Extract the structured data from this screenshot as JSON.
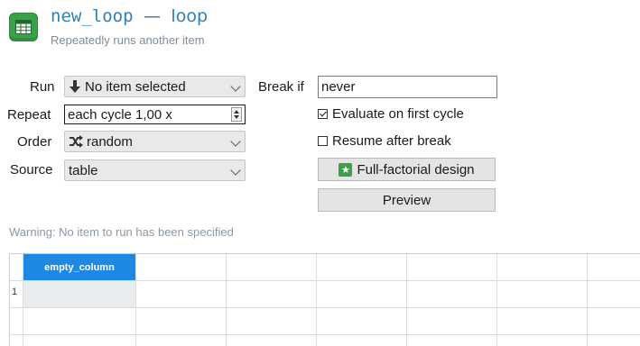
{
  "header": {
    "item_name": "new_loop",
    "separator": "—",
    "item_type": "loop",
    "description": "Repeatedly runs another item",
    "icon": "table-icon"
  },
  "form": {
    "run": {
      "label": "Run",
      "value": "No item selected",
      "icon": "down-arrow-icon"
    },
    "repeat": {
      "label": "Repeat",
      "value": "each cycle 1,00 x"
    },
    "order": {
      "label": "Order",
      "value": "random",
      "icon": "shuffle-icon"
    },
    "source": {
      "label": "Source",
      "value": "table"
    },
    "break_if": {
      "label": "Break if",
      "value": "never"
    },
    "evaluate_first": {
      "label": "Evaluate on first cycle",
      "checked": true
    },
    "resume_after_break": {
      "label": "Resume after break",
      "checked": false
    },
    "full_factorial_button": "Full-factorial design",
    "preview_button": "Preview"
  },
  "warning": "Warning: No item to run has been specified",
  "table": {
    "columns": [
      "empty_column"
    ],
    "rows": [
      [
        "1"
      ]
    ],
    "accent": "#1e88e5"
  },
  "colors": {
    "accent_blue": "#2f7fb8",
    "icon_green": "#3aa14a"
  }
}
